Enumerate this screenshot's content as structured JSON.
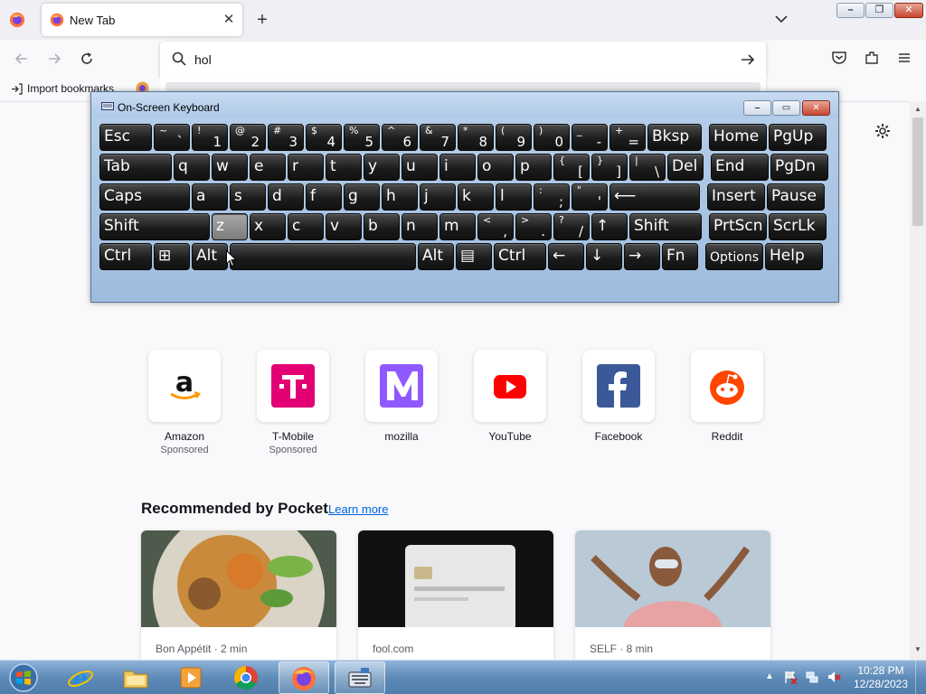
{
  "browser": {
    "tab": {
      "title": "New Tab",
      "close_glyph": "✕"
    },
    "new_tab_glyph": "+",
    "url_text": "hol",
    "bookmarks": {
      "import_label": "Import bookmarks"
    }
  },
  "window_controls": {
    "minimize": "–",
    "maximize": "❐",
    "close": "✕"
  },
  "shortcuts": [
    {
      "name": "Amazon",
      "sponsored": "Sponsored",
      "icon": "amazon-logo"
    },
    {
      "name": "T-Mobile",
      "sponsored": "Sponsored",
      "icon": "t-mobile-logo"
    },
    {
      "name": "mozilla",
      "sponsored": "",
      "icon": "mozilla-logo"
    },
    {
      "name": "YouTube",
      "sponsored": "",
      "icon": "youtube-logo"
    },
    {
      "name": "Facebook",
      "sponsored": "",
      "icon": "facebook-logo"
    },
    {
      "name": "Reddit",
      "sponsored": "",
      "icon": "reddit-logo"
    }
  ],
  "pocket": {
    "title": "Recommended by Pocket",
    "learn_more": "Learn more",
    "cards": [
      {
        "source": "Bon Appétit · 2 min"
      },
      {
        "source": "fool.com"
      },
      {
        "source": "SELF · 8 min"
      }
    ]
  },
  "osk": {
    "title": "On-Screen Keyboard",
    "controls": {
      "minimize": "–",
      "restore": "▭",
      "close": "✕"
    },
    "rows": [
      [
        {
          "label": "Esc"
        },
        {
          "top": "~",
          "bot": "`"
        },
        {
          "top": "!",
          "bot": "1"
        },
        {
          "top": "@",
          "bot": "2"
        },
        {
          "top": "#",
          "bot": "3"
        },
        {
          "top": "$",
          "bot": "4"
        },
        {
          "top": "%",
          "bot": "5"
        },
        {
          "top": "^",
          "bot": "6"
        },
        {
          "top": "&",
          "bot": "7"
        },
        {
          "top": "*",
          "bot": "8"
        },
        {
          "top": "(",
          "bot": "9"
        },
        {
          "top": ")",
          "bot": "0"
        },
        {
          "top": "_",
          "bot": "-"
        },
        {
          "top": "+",
          "bot": "="
        },
        {
          "label": "Bksp"
        },
        {
          "label": "Home"
        },
        {
          "label": "PgUp"
        }
      ],
      [
        {
          "label": "Tab"
        },
        {
          "label": "q"
        },
        {
          "label": "w"
        },
        {
          "label": "e"
        },
        {
          "label": "r"
        },
        {
          "label": "t"
        },
        {
          "label": "y"
        },
        {
          "label": "u"
        },
        {
          "label": "i"
        },
        {
          "label": "o"
        },
        {
          "label": "p"
        },
        {
          "top": "{",
          "bot": "["
        },
        {
          "top": "}",
          "bot": "]"
        },
        {
          "top": "|",
          "bot": "\\"
        },
        {
          "label": "Del"
        },
        {
          "label": "End"
        },
        {
          "label": "PgDn"
        }
      ],
      [
        {
          "label": "Caps"
        },
        {
          "label": "a"
        },
        {
          "label": "s"
        },
        {
          "label": "d"
        },
        {
          "label": "f"
        },
        {
          "label": "g"
        },
        {
          "label": "h"
        },
        {
          "label": "j"
        },
        {
          "label": "k"
        },
        {
          "label": "l"
        },
        {
          "top": ":",
          "bot": ";"
        },
        {
          "top": "\"",
          "bot": "'"
        },
        {
          "label": "⟵"
        },
        {
          "label": "Insert"
        },
        {
          "label": "Pause"
        }
      ],
      [
        {
          "label": "Shift"
        },
        {
          "label": "z"
        },
        {
          "label": "x"
        },
        {
          "label": "c"
        },
        {
          "label": "v"
        },
        {
          "label": "b"
        },
        {
          "label": "n"
        },
        {
          "label": "m"
        },
        {
          "top": "<",
          "bot": ","
        },
        {
          "top": ">",
          "bot": "."
        },
        {
          "top": "?",
          "bot": "/"
        },
        {
          "label": "↑"
        },
        {
          "label": "Shift"
        },
        {
          "label": "PrtScn"
        },
        {
          "label": "ScrLk"
        }
      ],
      [
        {
          "label": "Ctrl"
        },
        {
          "label": "⊞"
        },
        {
          "label": "Alt"
        },
        {
          "label": ""
        },
        {
          "label": "Alt"
        },
        {
          "label": "▤"
        },
        {
          "label": "Ctrl"
        },
        {
          "label": "←"
        },
        {
          "label": "↓"
        },
        {
          "label": "→"
        },
        {
          "label": "Fn"
        },
        {
          "label": "Options"
        },
        {
          "label": "Help"
        }
      ]
    ]
  },
  "taskbar": {
    "apps": [
      "windows-explorer",
      "internet-explorer",
      "file-manager",
      "media-player",
      "chrome",
      "firefox",
      "on-screen-keyboard"
    ],
    "time": "10:28 PM",
    "date": "12/28/2023"
  }
}
